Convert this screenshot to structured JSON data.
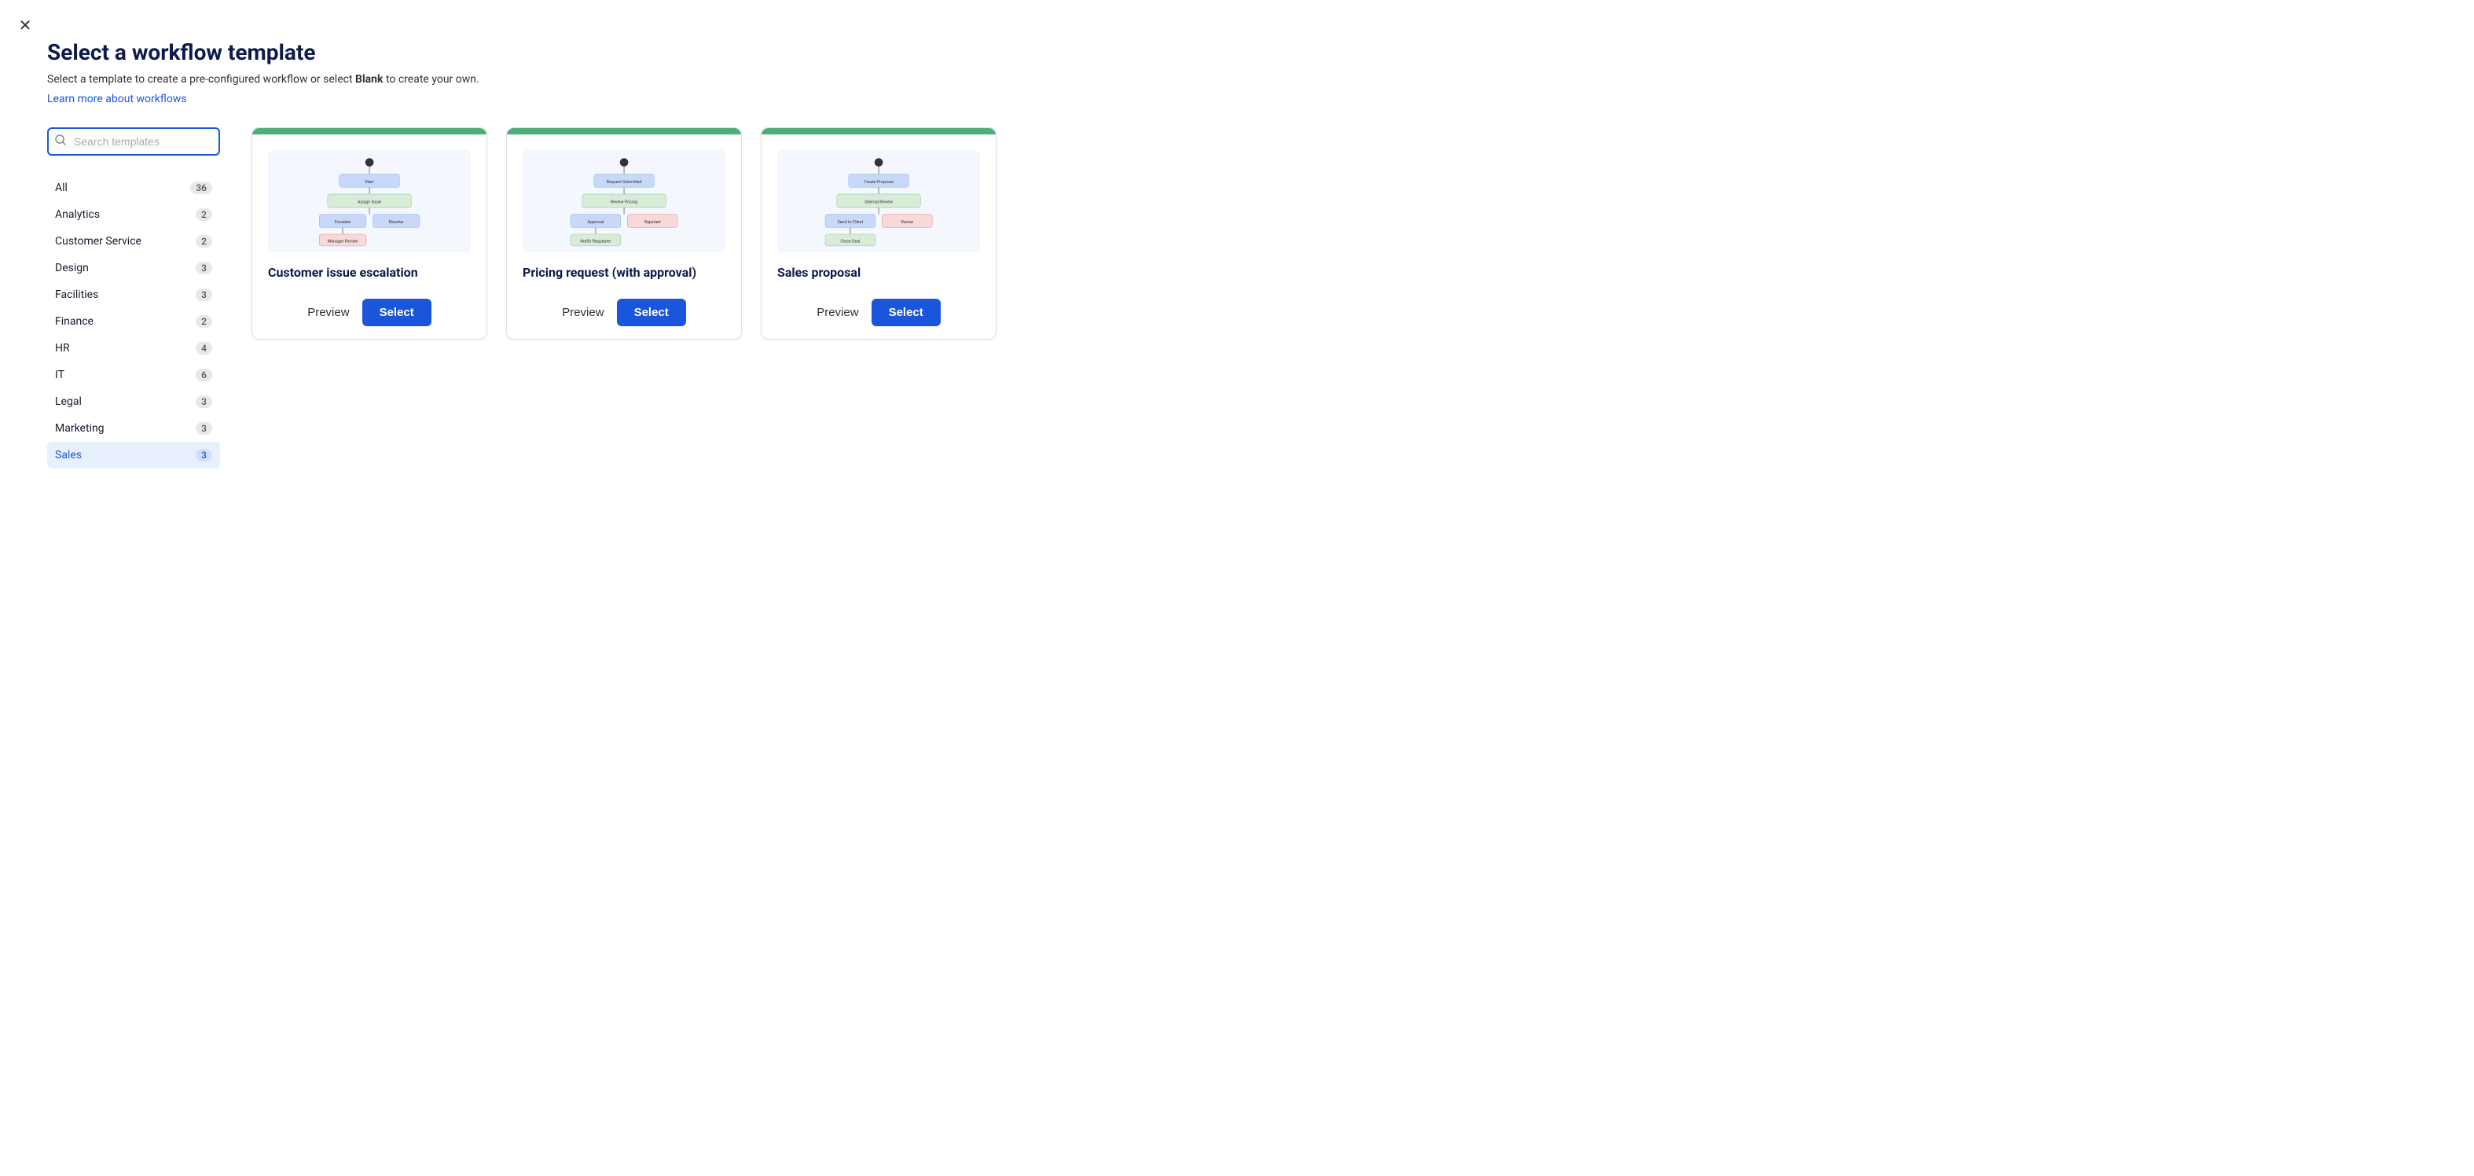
{
  "close_label": "✕",
  "header": {
    "title": "Select a workflow template",
    "subtitle_start": "Select a template to create a pre-configured workflow or select ",
    "subtitle_bold": "Blank",
    "subtitle_end": " to create your own.",
    "learn_more": "Learn more about workflows"
  },
  "search": {
    "placeholder": "Search templates"
  },
  "categories": [
    {
      "id": "all",
      "label": "All",
      "count": 36,
      "active": false
    },
    {
      "id": "analytics",
      "label": "Analytics",
      "count": 2,
      "active": false
    },
    {
      "id": "customer-service",
      "label": "Customer Service",
      "count": 2,
      "active": false
    },
    {
      "id": "design",
      "label": "Design",
      "count": 3,
      "active": false
    },
    {
      "id": "facilities",
      "label": "Facilities",
      "count": 3,
      "active": false
    },
    {
      "id": "finance",
      "label": "Finance",
      "count": 2,
      "active": false
    },
    {
      "id": "hr",
      "label": "HR",
      "count": 4,
      "active": false
    },
    {
      "id": "it",
      "label": "IT",
      "count": 6,
      "active": false
    },
    {
      "id": "legal",
      "label": "Legal",
      "count": 3,
      "active": false
    },
    {
      "id": "marketing",
      "label": "Marketing",
      "count": 3,
      "active": false
    },
    {
      "id": "sales",
      "label": "Sales",
      "count": 3,
      "active": true
    }
  ],
  "templates": [
    {
      "id": "customer-issue-escalation",
      "name": "Customer issue escalation",
      "preview_label": "Preview",
      "select_label": "Select"
    },
    {
      "id": "pricing-request",
      "name": "Pricing request (with approval)",
      "preview_label": "Preview",
      "select_label": "Select"
    },
    {
      "id": "sales-proposal",
      "name": "Sales proposal",
      "preview_label": "Preview",
      "select_label": "Select"
    }
  ]
}
